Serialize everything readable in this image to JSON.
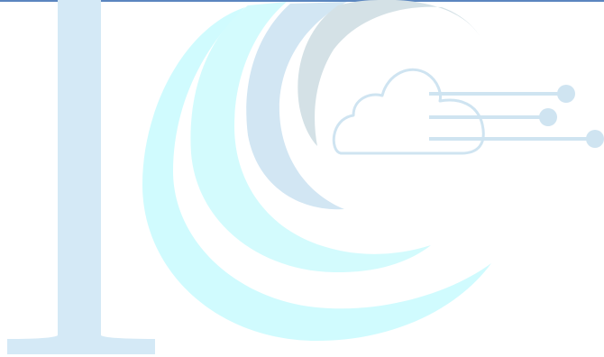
{
  "header": {
    "rule_color": "#5b86bf"
  },
  "watermark": {
    "icon": "ic-cloud-logo-watermark",
    "colors": {
      "letter": "#d4e9f6",
      "arc_outer": "#d0fbfe",
      "arc_middle": "#d3fbfd",
      "arc_inner": "#d2e6f3",
      "arc_innermost": "#d4e1e6",
      "cloud": "#cfe4f1",
      "lines": "#cfe4f1"
    }
  }
}
